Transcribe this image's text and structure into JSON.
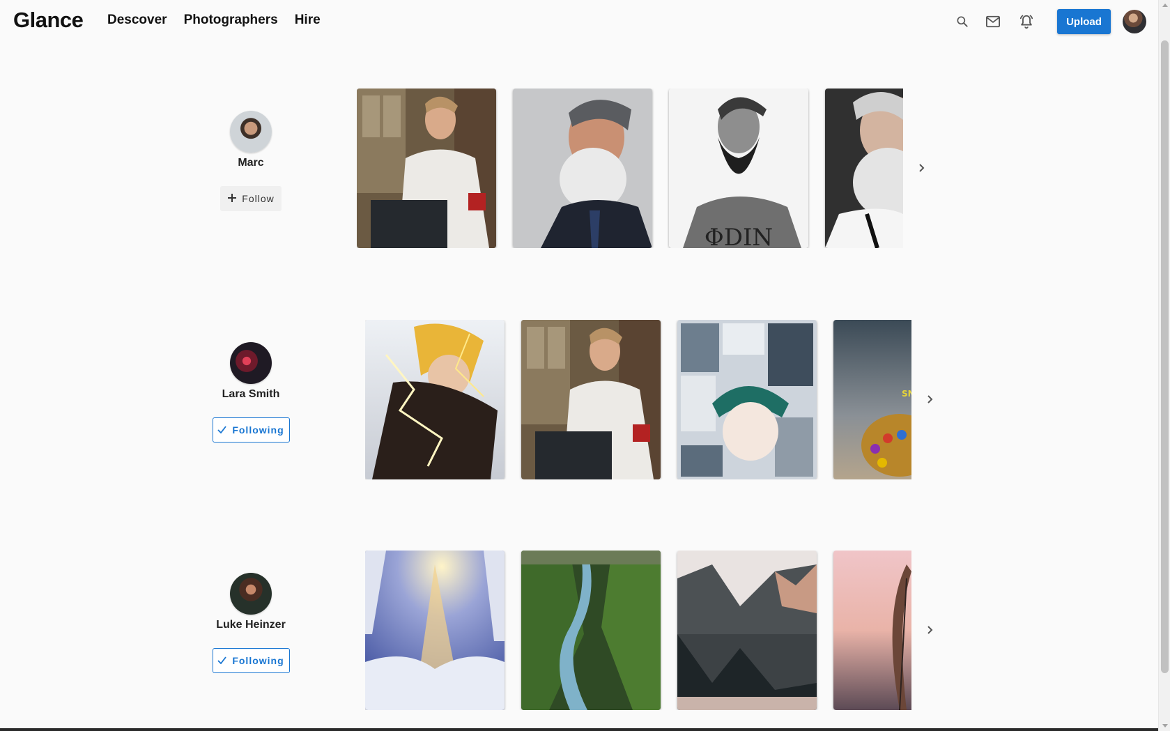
{
  "app": {
    "logo": "Glance"
  },
  "nav": [
    {
      "label": "Descover"
    },
    {
      "label": "Photographers"
    },
    {
      "label": "Hire"
    }
  ],
  "header": {
    "upload_label": "Upload",
    "icons": [
      "search-icon",
      "mail-icon",
      "bell-icon"
    ]
  },
  "rows": [
    {
      "name": "Marc",
      "button": {
        "label": "Follow",
        "state": "follow",
        "icon": "plus-icon"
      },
      "photos": [
        "man-white-shirt-armband",
        "grey-beard-suit",
        "bearded-man-odin-tee",
        "white-beard-portrait"
      ]
    },
    {
      "name": "Lara Smith",
      "button": {
        "label": "Following",
        "state": "following",
        "icon": "check-icon"
      },
      "photos": [
        "anime-lightning-character",
        "man-white-shirt-armband",
        "anime-manga-collage",
        "infinity-gauntlet"
      ]
    },
    {
      "name": "Luke Heinzer",
      "button": {
        "label": "Following",
        "state": "following",
        "icon": "check-icon"
      },
      "photos": [
        "snowy-forest-sunlight",
        "green-gorge-river",
        "mountain-lake-reflection",
        "feather-sunset"
      ]
    }
  ],
  "colors": {
    "accent": "#1976d2",
    "background": "#fafafa"
  }
}
